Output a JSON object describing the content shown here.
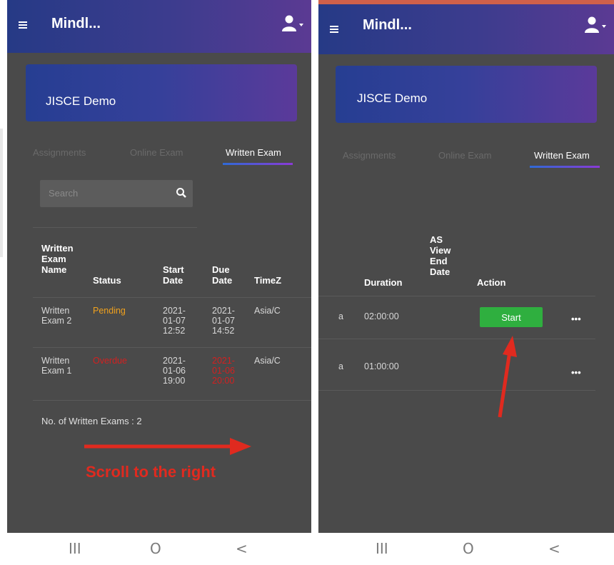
{
  "app": {
    "title": "Mindl..."
  },
  "course": {
    "title": "JISCE Demo"
  },
  "tabs": [
    {
      "label": "Assignments"
    },
    {
      "label": "Online Exam"
    },
    {
      "label": "Written Exam"
    }
  ],
  "search": {
    "placeholder": "Search"
  },
  "table_left": {
    "headers": [
      "Written\nExam\nName",
      "Status",
      "Start\nDate",
      "Due\nDate",
      "TimeZ"
    ],
    "rows": [
      {
        "name": "Written\nExam 2",
        "status": "Pending",
        "start": "2021-\n01-07\n12:52",
        "due": "2021-\n01-07\n14:52",
        "tz": "Asia/C"
      },
      {
        "name": "Written\nExam 1",
        "status": "Overdue",
        "start": "2021-\n01-06\n19:00",
        "due": "2021-\n01-06\n20:00",
        "tz": "Asia/C"
      }
    ]
  },
  "count_label": "No. of Written Exams : 2",
  "annotation": {
    "scroll_text": "Scroll to the right"
  },
  "table_right": {
    "headers": [
      "Duration",
      "AS\nView\nEnd\nDate",
      "Action"
    ],
    "rows": [
      {
        "tz_tail": "a",
        "duration": "02:00:00",
        "action": "Start",
        "more": "•••"
      },
      {
        "tz_tail": "a",
        "duration": "01:00:00",
        "action": "",
        "more": "•••"
      }
    ]
  },
  "navbar": {
    "recents": "III",
    "home": "O",
    "back": "<"
  },
  "colors": {
    "appbar": "#263a86",
    "pending": "#f0a11d",
    "overdue": "#d32020",
    "start_button": "#2faf3f",
    "annotation": "#e02a1f"
  }
}
